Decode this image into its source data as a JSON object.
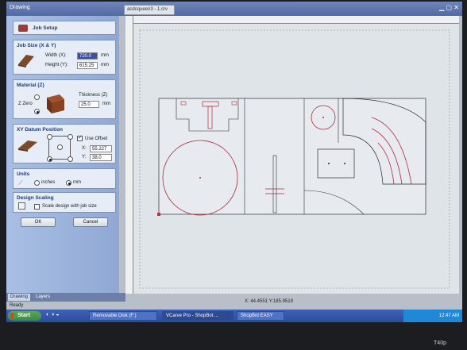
{
  "window": {
    "pane_title": "Drawing",
    "file_tab": "acdcqueen3 - 1.crv"
  },
  "job_setup": {
    "title": "Job Setup",
    "job_size": {
      "title": "Job Size (X & Y)",
      "width_label": "Width (X):",
      "width_value": "720.0",
      "height_label": "Height (Y):",
      "height_value": "615.25",
      "unit": "mm"
    },
    "material": {
      "title": "Material (Z)",
      "z_zero_label": "Z Zero",
      "thickness_label": "Thickness (Z)",
      "thickness_value": "25.0",
      "unit": "mm"
    },
    "datum": {
      "title": "XY Datum Position",
      "use_offset_label": "Use Offset",
      "x_label": "X:",
      "x_value": "55.227",
      "y_label": "Y:",
      "y_value": "38.0"
    },
    "units": {
      "title": "Units",
      "inches_label": "inches",
      "mm_label": "mm"
    },
    "design_scaling": {
      "title": "Design Scaling",
      "scale_label": "Scale design with job size"
    },
    "ok_label": "OK",
    "cancel_label": "Cancel"
  },
  "panel_tabs": [
    "Drawing",
    "Layers"
  ],
  "status": {
    "ready": "Ready",
    "coords": "X: 44.4551 Y:185.9519"
  },
  "taskbar": {
    "start": "Start",
    "items": [
      {
        "label": "Removable Disk (F:)"
      },
      {
        "label": "VCarve Pro - ShopBot ..."
      },
      {
        "label": "ShopBot EASY"
      }
    ],
    "clock": "12:47 AM"
  },
  "brand": "T40p",
  "colors": {
    "panel_blue": "#8fa8d4",
    "accent_red": "#c0303a",
    "canvas_bg": "#dfe4e9"
  }
}
